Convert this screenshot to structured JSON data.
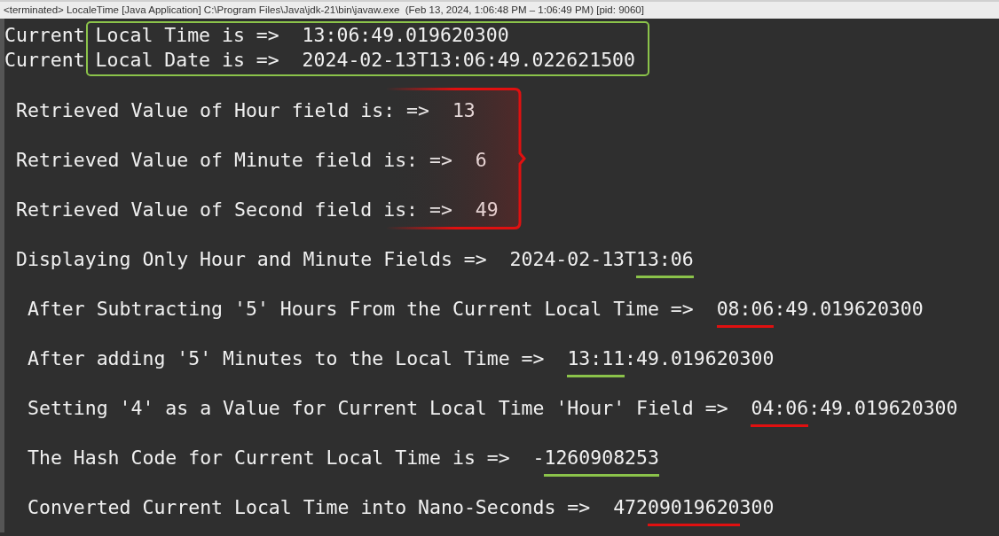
{
  "console_header": {
    "text": "<terminated> LocaleTime [Java Application] C:\\Program Files\\Java\\jdk-21\\bin\\javaw.exe  (Feb 13, 2024, 1:06:48 PM – 1:06:49 PM) [pid: 9060]"
  },
  "current_lines": {
    "frame": {
      "color": "#8bc34a"
    },
    "items": [
      {
        "prefix": "Current",
        "text": "Local Time is =>  13:06:49.019620300"
      },
      {
        "prefix": "Current",
        "text": "Local Date is =>  2024-02-13T13:06:49.022621500"
      }
    ]
  },
  "retrieved_lines": {
    "bracket": {
      "color": "#e01010"
    },
    "items": [
      {
        "text": "Retrieved Value of Hour field is: =>  13"
      },
      {
        "text": "Retrieved Value of Minute field is: =>  6"
      },
      {
        "text": "Retrieved Value of Second field is: =>  49"
      }
    ]
  },
  "lines": [
    {
      "kind": "field",
      "parts": [
        {
          "text": "Displaying Only Hour and Minute Fields =>  2024-02-13T"
        },
        {
          "text": "13:06",
          "color": "#8bc34a"
        }
      ]
    },
    {
      "kind": "result",
      "parts": [
        {
          "text": "After Subtracting '5' Hours From the Current Local Time =>  "
        },
        {
          "text": "08:06",
          "color": "#e01010"
        },
        {
          "text": ":49.019620300"
        }
      ]
    },
    {
      "kind": "result",
      "parts": [
        {
          "text": "After adding '5' Minutes to the Local Time =>  "
        },
        {
          "text": "13:11",
          "color": "#8bc34a"
        },
        {
          "text": ":49.019620300"
        }
      ]
    },
    {
      "kind": "result",
      "parts": [
        {
          "text": "Setting '4' as a Value for Current Local Time 'Hour' Field =>  "
        },
        {
          "text": "04:06",
          "color": "#e01010"
        },
        {
          "text": ":49.019620300"
        }
      ]
    },
    {
      "kind": "result",
      "parts": [
        {
          "text": "The Hash Code for Current Local Time is =>  -"
        },
        {
          "text": "1260908253",
          "color": "#8bc34a"
        }
      ]
    },
    {
      "kind": "result",
      "parts": [
        {
          "text": "Converted Current Local Time into Nano-Seconds =>  472"
        },
        {
          "text": "09019620",
          "color": "#e01010"
        },
        {
          "text": "300"
        }
      ]
    }
  ]
}
